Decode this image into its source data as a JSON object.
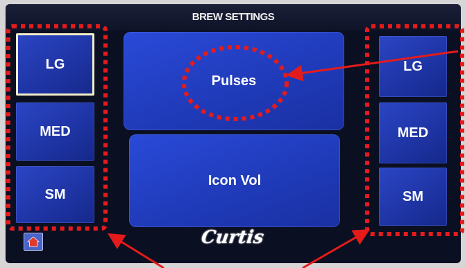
{
  "screen": {
    "title": "BREW SETTINGS"
  },
  "left_sizes": [
    {
      "label": "LG",
      "selected": true
    },
    {
      "label": "MED",
      "selected": false
    },
    {
      "label": "SM",
      "selected": false
    }
  ],
  "right_sizes": [
    {
      "label": "LG"
    },
    {
      "label": "MED"
    },
    {
      "label": "SM"
    }
  ],
  "main_buttons": [
    {
      "label": "Pulses"
    },
    {
      "label": "Icon Vol"
    }
  ],
  "footer": {
    "logo_text": "Curtis",
    "home_icon": "home-icon"
  },
  "colors": {
    "button_blue": "#1f35a6",
    "screen_background": "#0b0f22",
    "annotation_red": "#e51b1b",
    "selected_outline": "#f2eec8"
  }
}
